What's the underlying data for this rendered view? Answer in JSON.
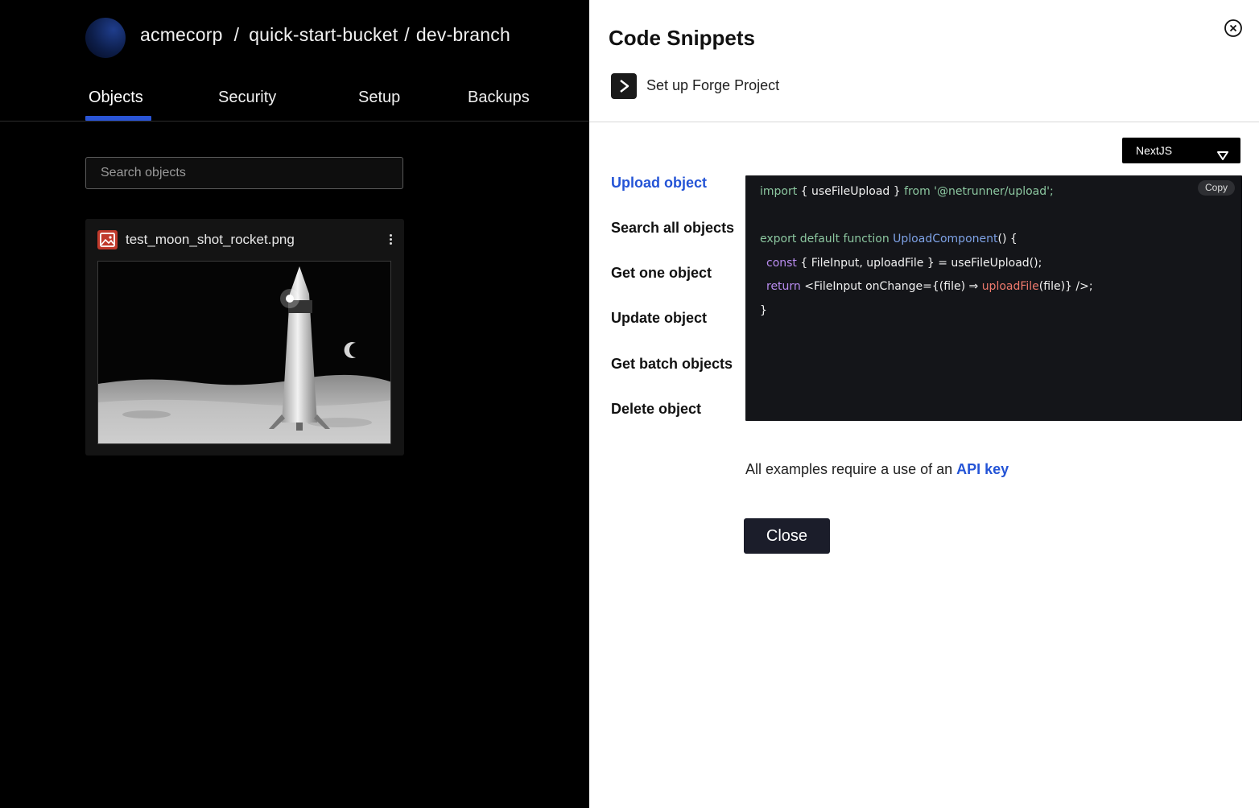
{
  "header": {
    "org": "acmecorp",
    "separator": "/",
    "bucket": "quick-start-bucket",
    "separator2": "/",
    "branch": "dev-branch"
  },
  "tabs": [
    {
      "label": "Objects",
      "active": true
    },
    {
      "label": "Security",
      "active": false
    },
    {
      "label": "Setup",
      "active": false
    },
    {
      "label": "Backups",
      "active": false
    }
  ],
  "search": {
    "placeholder": "Search objects"
  },
  "object_card": {
    "file_name": "test_moon_shot_rocket.png",
    "icon": "image-file-icon"
  },
  "panel": {
    "title": "Code Snippets",
    "forge_label": "Set up Forge Project",
    "language": "NextJS",
    "menu": [
      {
        "label": "Upload object",
        "active": true
      },
      {
        "label": "Search all objects",
        "active": false
      },
      {
        "label": "Get one object",
        "active": false
      },
      {
        "label": "Update object",
        "active": false
      },
      {
        "label": "Get batch objects",
        "active": false
      },
      {
        "label": "Delete object",
        "active": false
      }
    ],
    "copy_label": "Copy",
    "code": {
      "l1_kw": "import",
      "l1_mid": " { useFileUpload } ",
      "l1_from": "from",
      "l1_str": " '@netrunner/upload';",
      "l2_kw": "export default function",
      "l2_fn": " UploadComponent",
      "l2_end": "() {",
      "l3_kw": "const",
      "l3_rest": " { FileInput, uploadFile } = useFileUpload();",
      "l4_kw": "return",
      "l4_mid": " <FileInput onChange={(file) ⇒ ",
      "l4_fn": "uploadFile",
      "l4_end": "(file)} />;",
      "l5": "}"
    },
    "note_text": "All examples require a use of an ",
    "note_link": "API key",
    "close_label": "Close"
  },
  "colors": {
    "accent": "#2454d6",
    "panel_bg": "#ffffff",
    "app_bg": "#000000",
    "code_bg": "#141519"
  }
}
